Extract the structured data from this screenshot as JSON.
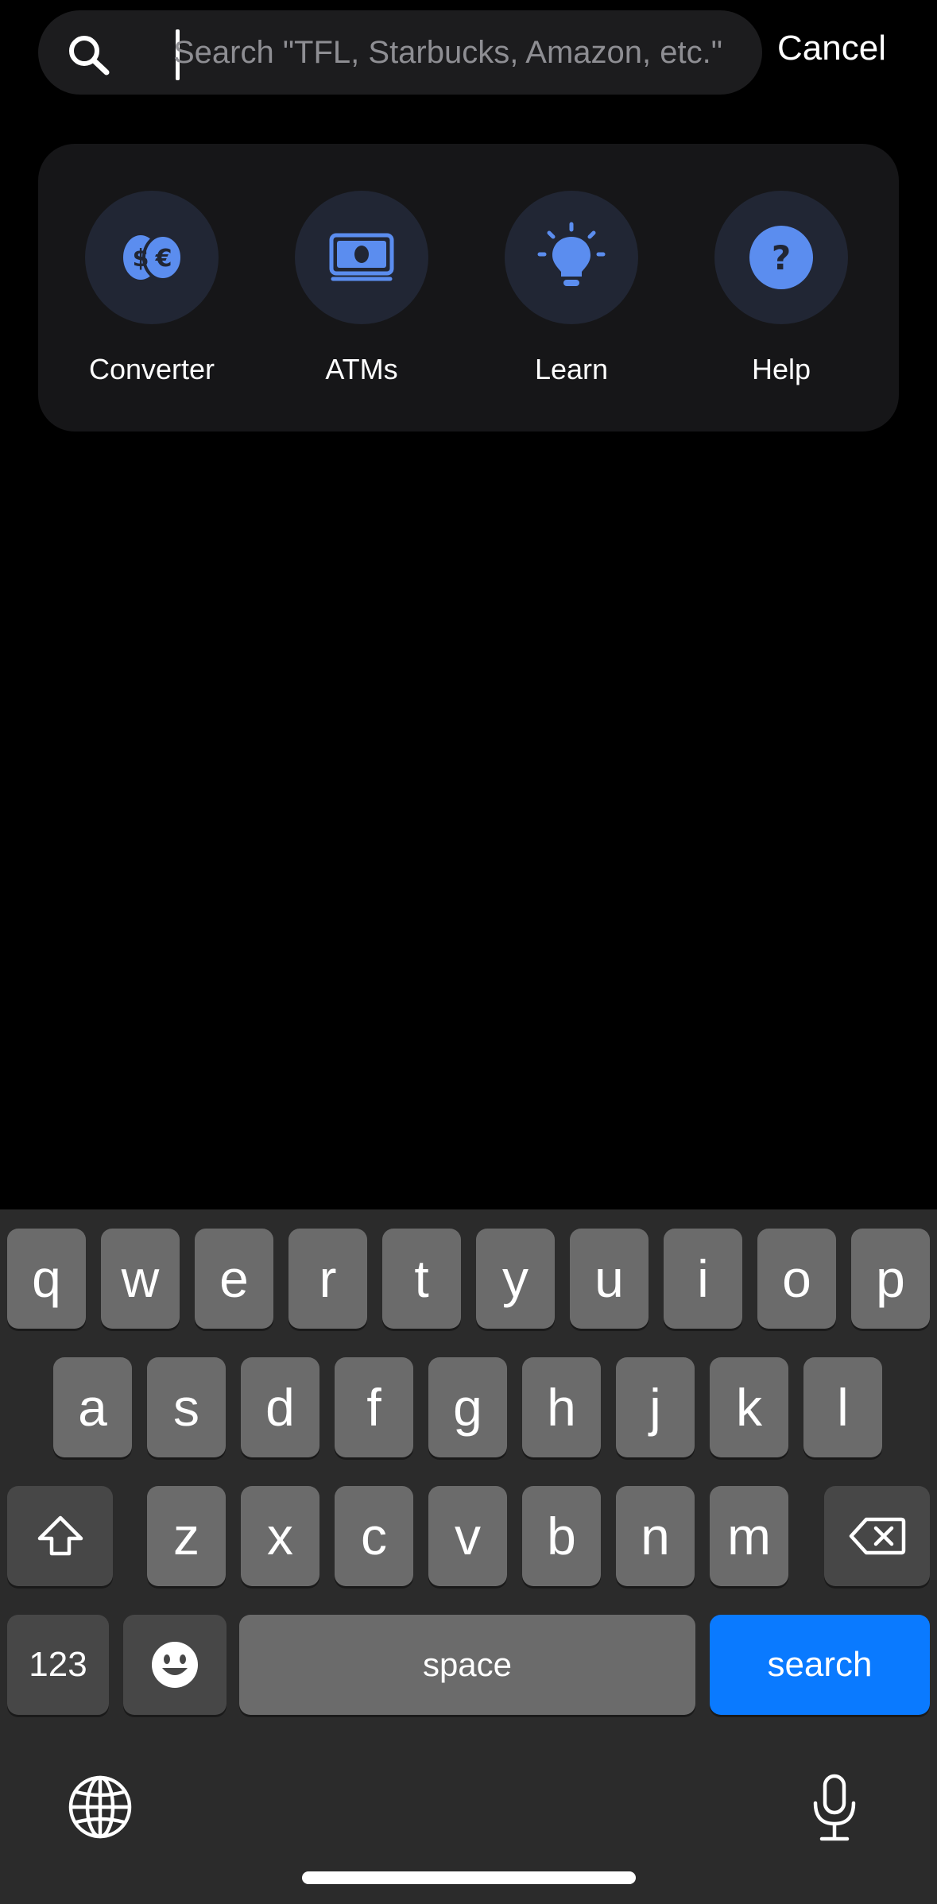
{
  "search": {
    "placeholder": "Search \"TFL, Starbucks, Amazon, etc.\"",
    "value": "",
    "cancel_label": "Cancel"
  },
  "quick_actions": [
    {
      "label": "Converter",
      "icon": "currency-exchange-icon"
    },
    {
      "label": "ATMs",
      "icon": "cash-icon"
    },
    {
      "label": "Learn",
      "icon": "lightbulb-icon"
    },
    {
      "label": "Help",
      "icon": "question-mark-icon"
    }
  ],
  "keyboard": {
    "row1": [
      "q",
      "w",
      "e",
      "r",
      "t",
      "y",
      "u",
      "i",
      "o",
      "p"
    ],
    "row2": [
      "a",
      "s",
      "d",
      "f",
      "g",
      "h",
      "j",
      "k",
      "l"
    ],
    "row3": [
      "z",
      "x",
      "c",
      "v",
      "b",
      "n",
      "m"
    ],
    "numbers_label": "123",
    "space_label": "space",
    "action_label": "search",
    "icons": {
      "shift": "shift-icon",
      "delete": "backspace-icon",
      "emoji": "emoji-icon",
      "globe": "globe-icon",
      "dictation": "microphone-icon"
    }
  },
  "colors": {
    "accent": "#5b8def",
    "action_bg": "#212634",
    "card_bg": "#161618",
    "search_key": "#0a7aff"
  }
}
